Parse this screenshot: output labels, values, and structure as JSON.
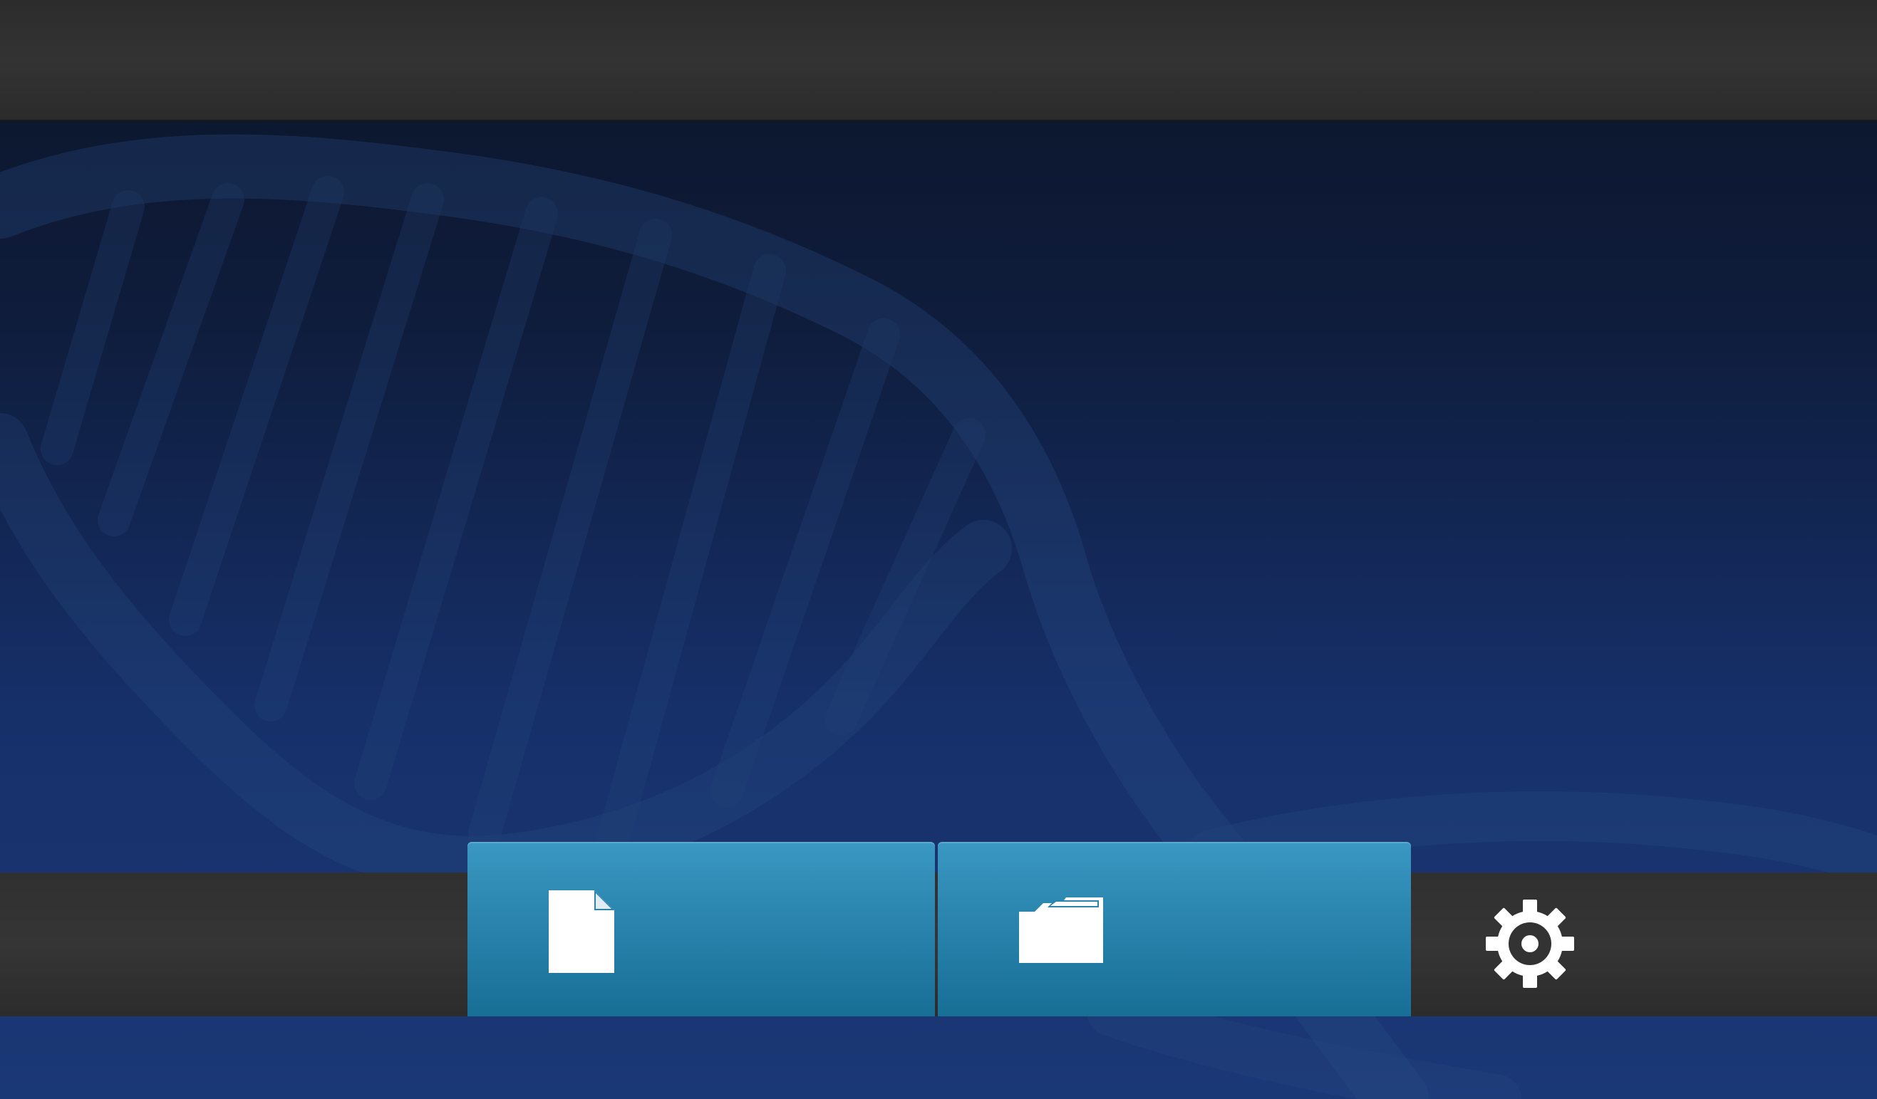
{
  "app": {
    "title": ""
  },
  "toolbar": {
    "new_file": {
      "label": "",
      "icon": "new-file-icon"
    },
    "open_folder": {
      "label": "",
      "icon": "open-folder-icon"
    },
    "settings": {
      "icon": "gear-icon"
    }
  },
  "colors": {
    "top_bar": "#2e2e2e",
    "toolbar": "#333333",
    "accent_tab": "#2a84ad",
    "background_top": "#0b1428",
    "background_bottom": "#1b3876",
    "icon": "#ffffff"
  }
}
